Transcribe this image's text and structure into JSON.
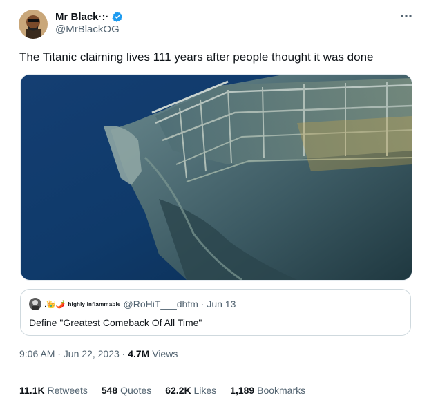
{
  "author": {
    "name": "Mr Black·:·",
    "handle": "@MrBlackOG",
    "verified_color": "#1d9bf0"
  },
  "tweet": {
    "text": "The Titanic claiming lives 111 years after people thought it was done"
  },
  "icons": {
    "more": "more-dots-icon",
    "verified": "verified-badge-icon"
  },
  "quote": {
    "decor_emojis": ".👑🌶️",
    "decor_text": "highly inflammable",
    "handle": "@RoHiT___dhfm · Jun 13",
    "text": "Define  \"Greatest Comeback Of All Time\""
  },
  "meta": {
    "time_date": "9:06 AM · Jun 22, 2023 · ",
    "views_count": "4.7M",
    "views_label": " Views"
  },
  "stats": {
    "retweets_count": "11.1K",
    "retweets_label": " Retweets",
    "quotes_count": "548",
    "quotes_label": " Quotes",
    "likes_count": "62.2K",
    "likes_label": " Likes",
    "bookmarks_count": "1,189",
    "bookmarks_label": " Bookmarks"
  }
}
